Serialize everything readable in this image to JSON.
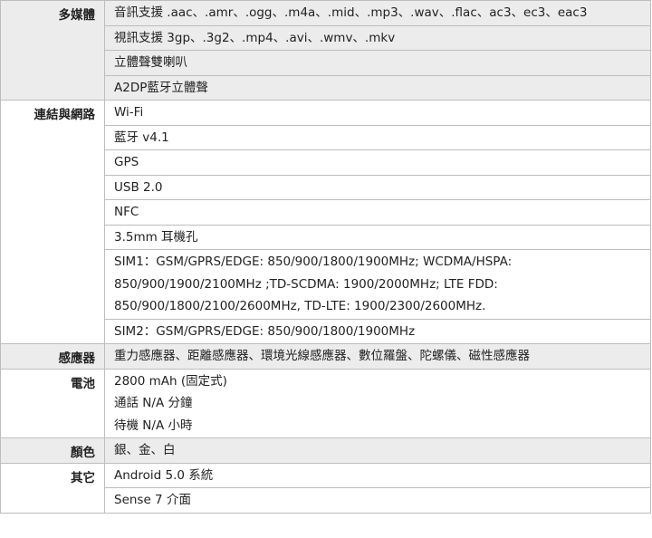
{
  "spec_table": [
    {
      "label": "多媒體",
      "shade": "g",
      "values": [
        "音訊支援 .aac、.amr、.ogg、.m4a、.mid、.mp3、.wav、.flac、ac3、ec3、eac3",
        "視訊支援 3gp、.3g2、.mp4、.avi、.wmv、.mkv",
        "立體聲雙喇叭",
        "A2DP藍牙立體聲"
      ]
    },
    {
      "label": "連結與網路",
      "shade": "w",
      "values": [
        "Wi-Fi",
        "藍牙 v4.1",
        "GPS",
        "USB 2.0",
        "NFC",
        "3.5mm 耳機孔",
        "SIM1：GSM/GPRS/EDGE: 850/900/1800/1900MHz; WCDMA/HSPA: 850/900/1900/2100MHz ;TD-SCDMA: 1900/2000MHz; LTE FDD: 850/900/1800/2100/2600MHz, TD-LTE: 1900/2300/2600MHz.",
        "SIM2：GSM/GPRS/EDGE: 850/900/1800/1900MHz"
      ]
    },
    {
      "label": "感應器",
      "shade": "g",
      "values": [
        "重力感應器、距離感應器、環境光線感應器、數位羅盤、陀螺儀、磁性感應器"
      ]
    },
    {
      "label": "電池",
      "shade": "w",
      "values": [
        [
          "2800 mAh (固定式)",
          "通話 N/A 分鐘",
          "待機 N/A 小時"
        ]
      ]
    },
    {
      "label": "顏色",
      "shade": "g",
      "values": [
        "銀、金、白"
      ]
    },
    {
      "label": "其它",
      "shade": "w",
      "values": [
        "Android 5.0 系統",
        "Sense 7 介面"
      ]
    }
  ]
}
